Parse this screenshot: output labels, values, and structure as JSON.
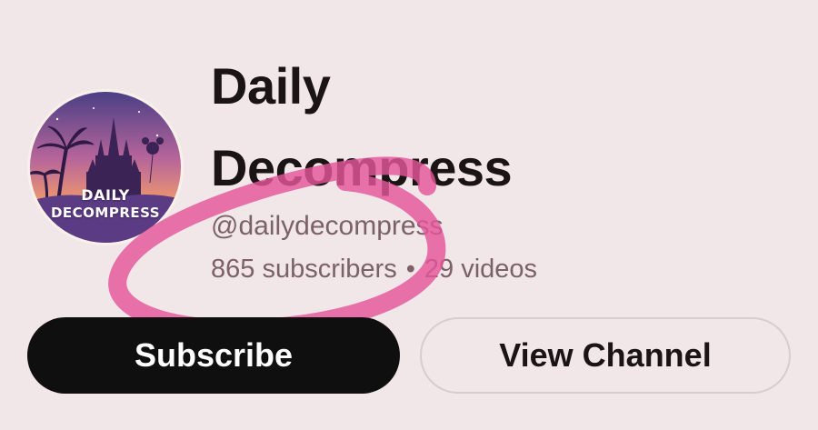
{
  "channel": {
    "name_line1": "Daily",
    "name_line2": "Decompress",
    "handle": "@dailydecompress",
    "subscribers": "865 subscribers",
    "separator": "•",
    "videos": "29 videos"
  },
  "avatar": {
    "line1": "DAILY",
    "line2": "DECOMPRESS"
  },
  "actions": {
    "subscribe_label": "Subscribe",
    "view_channel_label": "View Channel"
  },
  "colors": {
    "background": "#f1e6e8",
    "title": "#1a1414",
    "meta_text": "#7b6268",
    "subscribe_bg": "#0f0f0f",
    "highlight_circle": "#e4559a"
  }
}
